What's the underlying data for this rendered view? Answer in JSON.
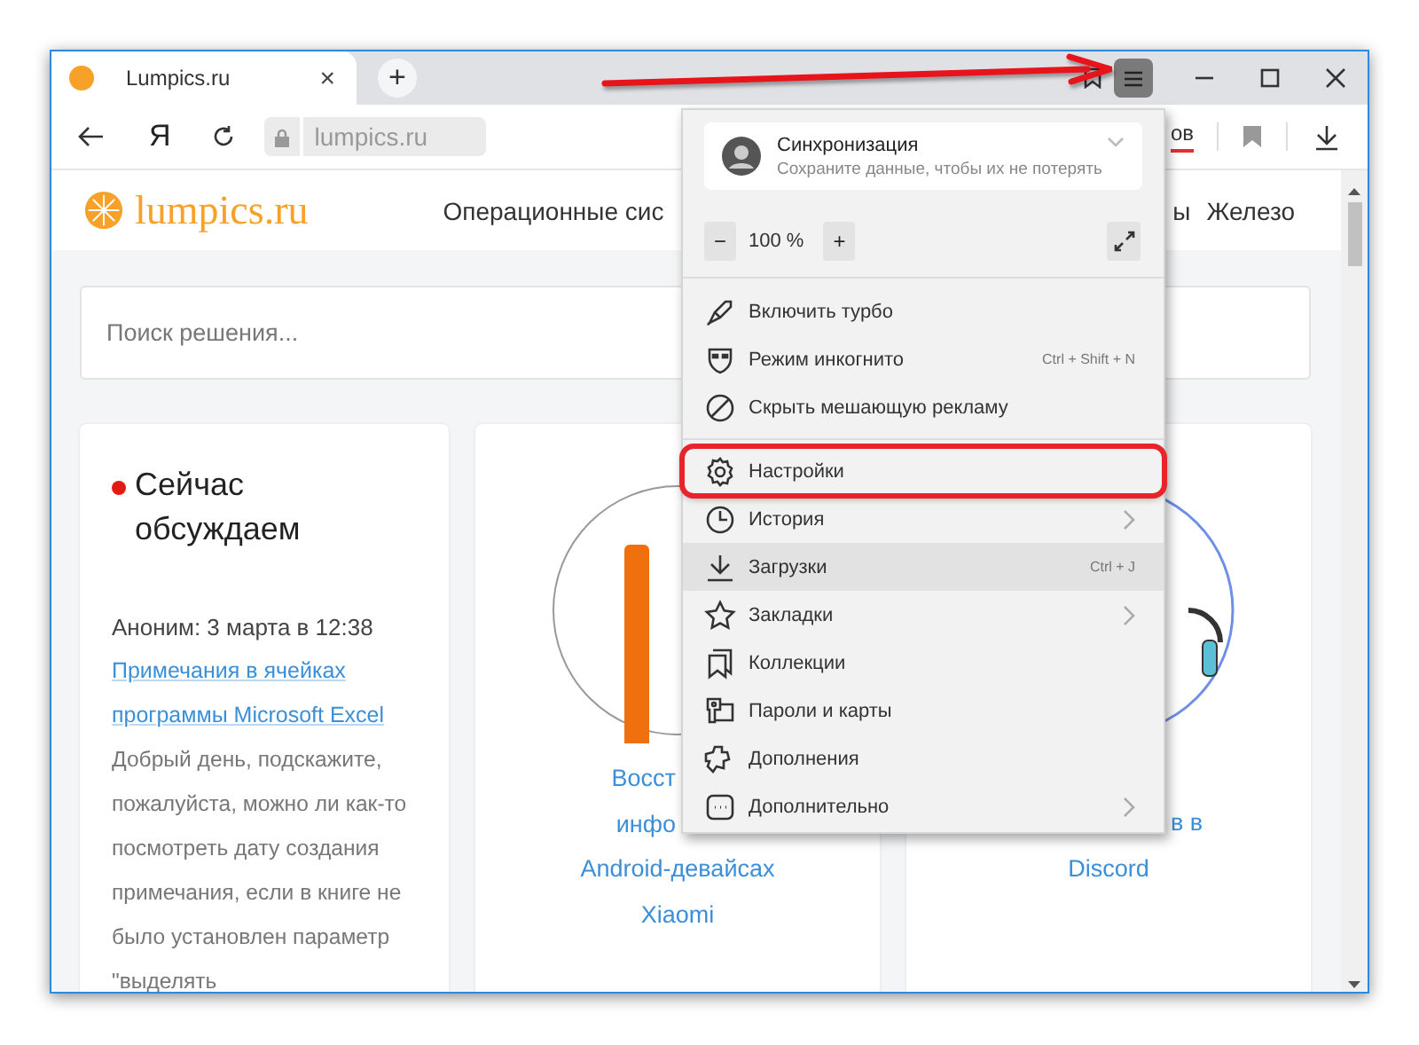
{
  "browser": {
    "tab": {
      "title": "Lumpics.ru",
      "close": "×"
    },
    "new_tab": "+",
    "home": "Я",
    "address": "lumpics.ru",
    "toolbar_link": "ов"
  },
  "site": {
    "logo": "lumpics.ru",
    "nav": [
      "Операционные сис",
      "ы",
      "Железо"
    ],
    "search": {
      "placeholder": "Поиск решения..."
    },
    "discussion": {
      "title": "Сейчас обсуждаем",
      "meta": "Аноним: 3 марта в 12:38",
      "link": "Примечания в ячейках программы Microsoft Excel",
      "excerpt": "Добрый день, подскажите, пожалуйста, можно ли как-то посмотреть дату создания примечания, если в книге не было установлен параметр \"выделять"
    },
    "articles": [
      {
        "lines": [
          {
            "text": "Восст",
            "kind": "cut"
          },
          {
            "text": "инфо",
            "kind": "cut"
          },
          {
            "text": "Android-девайсах",
            "kind": "full"
          },
          {
            "text": "Xiaomi",
            "kind": "full"
          }
        ]
      },
      {
        "lines": [
          {
            "text": "в в",
            "kind": "cut"
          },
          {
            "text": "Discord",
            "kind": "full"
          }
        ]
      }
    ]
  },
  "menu": {
    "sync": {
      "title": "Синхронизация",
      "subtitle": "Сохраните данные, чтобы их не потерять"
    },
    "zoom": {
      "minus": "−",
      "value": "100 %",
      "plus": "+"
    },
    "sections": [
      {
        "items": [
          {
            "label": "Включить турбо",
            "submenu": false,
            "hovered": false,
            "annotated": false
          },
          {
            "label": "Режим инкогнито",
            "shortcut": "Ctrl + Shift + N",
            "submenu": false,
            "hovered": false,
            "annotated": false
          },
          {
            "label": "Скрыть мешающую рекламу",
            "submenu": false,
            "hovered": false,
            "annotated": false
          }
        ]
      },
      {
        "items": [
          {
            "label": "Настройки",
            "submenu": false,
            "hovered": false,
            "annotated": true
          },
          {
            "label": "История",
            "submenu": true,
            "hovered": false,
            "annotated": false
          },
          {
            "label": "Загрузки",
            "shortcut": "Ctrl + J",
            "submenu": false,
            "hovered": true,
            "annotated": false
          },
          {
            "label": "Закладки",
            "submenu": true,
            "hovered": false,
            "annotated": false
          },
          {
            "label": "Коллекции",
            "submenu": false,
            "hovered": false,
            "annotated": false
          },
          {
            "label": "Пароли и карты",
            "submenu": false,
            "hovered": false,
            "annotated": false
          },
          {
            "label": "Дополнения",
            "submenu": false,
            "hovered": false,
            "annotated": false
          },
          {
            "label": "Дополнительно",
            "submenu": true,
            "hovered": false,
            "annotated": false
          }
        ]
      }
    ]
  }
}
